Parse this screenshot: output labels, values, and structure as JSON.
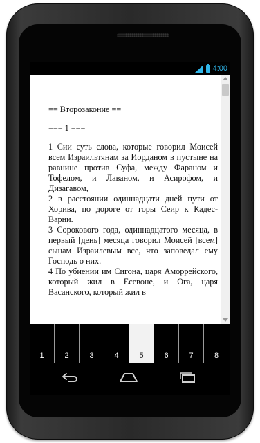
{
  "status": {
    "time": "4:00"
  },
  "reader": {
    "paragraphs": [
      "== Второзаконие ==",
      "=== 1 ===",
      "1 Сии суть слова, которые говорил Моисей всем Израильтянам за Иорданом в пустыне на равнине против Суфа, между Фараном и Тофелом, и Лаваном, и Асирофом, и Дизагавом,",
      "2 в расстоянии одиннадцати дней пути от Хорива, по дороге от горы Сеир к Кадес-Варни.",
      "3 Сорокового года, одиннадцатого месяца, в первый [день] месяца говорил Моисей [всем] сынам Израилевым все, что заповедал ему Господь о них.",
      "4 По убиении им Сигона, царя Аморрейского, который жил в Есевоне, и Ога, царя Васанского, который жил в"
    ]
  },
  "pages": {
    "tabs": [
      "1",
      "2",
      "3",
      "4",
      "5",
      "6",
      "7",
      "8"
    ],
    "active": "5"
  },
  "icons": {
    "signal": "signal-icon",
    "battery": "battery-icon",
    "back": "back-icon",
    "home": "home-icon",
    "recents": "recents-icon"
  },
  "colors": {
    "status_accent": "#2fb5e9",
    "active_tab_bg": "#f2f2f2"
  }
}
